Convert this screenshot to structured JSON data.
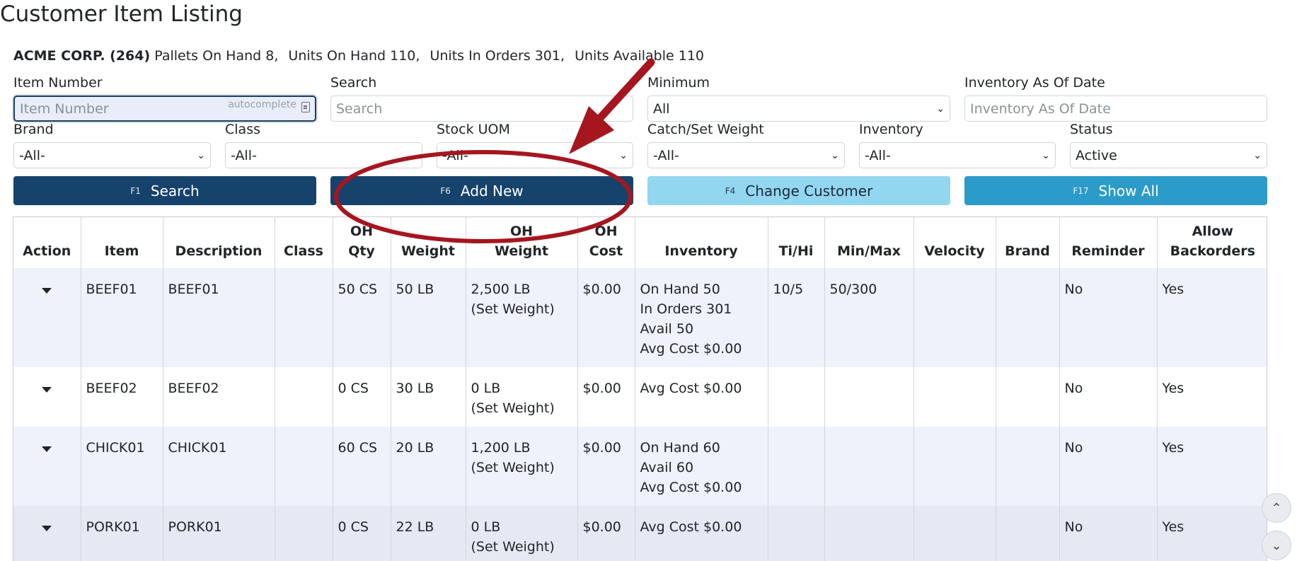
{
  "page": {
    "title": "Customer Item Listing"
  },
  "summary": {
    "customer": "ACME CORP. (264)",
    "pallets": "Pallets On Hand 8,",
    "units_on_hand": "Units On Hand 110,",
    "units_in_orders": "Units In Orders 301,",
    "units_available": "Units Available 110"
  },
  "filters": {
    "item_number": {
      "label": "Item Number",
      "placeholder": "Item Number",
      "tag": "autocomplete"
    },
    "search": {
      "label": "Search",
      "placeholder": "Search"
    },
    "minimum": {
      "label": "Minimum",
      "value": "All"
    },
    "inventory_date": {
      "label": "Inventory As Of Date",
      "placeholder": "Inventory As Of Date"
    },
    "brand": {
      "label": "Brand",
      "value": "-All-"
    },
    "class": {
      "label": "Class",
      "value": "-All-"
    },
    "stock_uom": {
      "label": "Stock UOM",
      "value": "-All-"
    },
    "catch_weight": {
      "label": "Catch/Set Weight",
      "value": "-All-"
    },
    "inventory": {
      "label": "Inventory",
      "value": "-All-"
    },
    "status": {
      "label": "Status",
      "value": "Active"
    }
  },
  "buttons": {
    "search": {
      "key": "F1",
      "label": "Search"
    },
    "add_new": {
      "key": "F6",
      "label": "Add New"
    },
    "change_customer": {
      "key": "F4",
      "label": "Change Customer"
    },
    "show_all": {
      "key": "F17",
      "label": "Show All"
    }
  },
  "table": {
    "headers": {
      "action": "Action",
      "item": "Item",
      "description": "Description",
      "class": "Class",
      "oh_qty": "OH\nQty",
      "weight": "Weight",
      "oh_weight": "OH\nWeight",
      "oh_cost": "OH\nCost",
      "inventory": "Inventory",
      "tihi": "Ti/Hi",
      "minmax": "Min/Max",
      "velocity": "Velocity",
      "brand": "Brand",
      "reminder": "Reminder",
      "backorders": "Allow\nBackorders"
    },
    "rows": [
      {
        "item": "BEEF01",
        "description": "BEEF01",
        "class": "",
        "oh_qty": "50 CS",
        "weight": "50 LB",
        "oh_weight": "2,500 LB\n(Set Weight)",
        "oh_cost": "$0.00",
        "inventory": "On Hand 50\nIn Orders 301\nAvail 50\nAvg Cost $0.00",
        "tihi": "10/5",
        "minmax": "50/300",
        "velocity": "",
        "brand": "",
        "reminder": "No",
        "backorders": "Yes"
      },
      {
        "item": "BEEF02",
        "description": "BEEF02",
        "class": "",
        "oh_qty": "0 CS",
        "weight": "30 LB",
        "oh_weight": "0 LB\n(Set Weight)",
        "oh_cost": "$0.00",
        "inventory": "Avg Cost $0.00",
        "tihi": "",
        "minmax": "",
        "velocity": "",
        "brand": "",
        "reminder": "No",
        "backorders": "Yes"
      },
      {
        "item": "CHICK01",
        "description": "CHICK01",
        "class": "",
        "oh_qty": "60 CS",
        "weight": "20 LB",
        "oh_weight": "1,200 LB\n(Set Weight)",
        "oh_cost": "$0.00",
        "inventory": "On Hand 60\nAvail 60\nAvg Cost $0.00",
        "tihi": "",
        "minmax": "",
        "velocity": "",
        "brand": "",
        "reminder": "No",
        "backorders": "Yes"
      },
      {
        "item": "PORK01",
        "description": "PORK01",
        "class": "",
        "oh_qty": "0 CS",
        "weight": "22 LB",
        "oh_weight": "0 LB\n(Set Weight)",
        "oh_cost": "$0.00",
        "inventory": "Avg Cost $0.00",
        "tihi": "",
        "minmax": "",
        "velocity": "",
        "brand": "",
        "reminder": "No",
        "backorders": "Yes"
      }
    ]
  },
  "colors": {
    "primary": "#16436b",
    "light_button": "#93d6ef",
    "mid_button": "#2b9bc9",
    "annotation": "#a5161f"
  }
}
